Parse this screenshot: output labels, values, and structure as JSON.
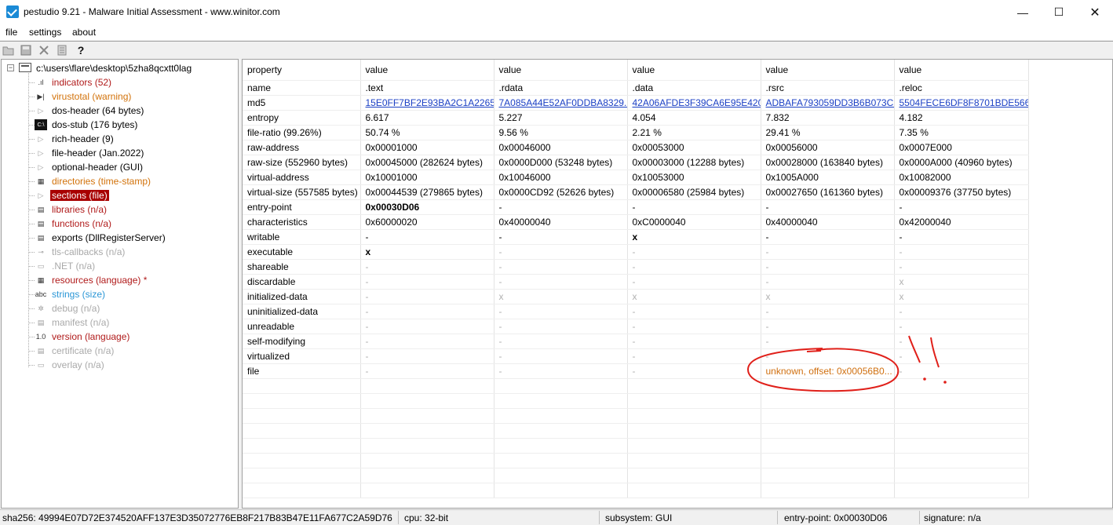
{
  "window": {
    "title": "pestudio 9.21 - Malware Initial Assessment - www.winitor.com",
    "minimize": "—",
    "maximize": "☐",
    "close": "✕"
  },
  "menu": {
    "items": [
      "file",
      "settings",
      "about"
    ]
  },
  "toolbar": {
    "icons": [
      "open-folder-icon",
      "save-icon",
      "close-file-icon",
      "document-icon",
      "help-icon"
    ]
  },
  "tree": {
    "root": "c:\\users\\flare\\desktop\\5zha8qcxtt0lag",
    "items": [
      {
        "label": "indicators (52)",
        "color": "red",
        "icon": "bar-chart-icon"
      },
      {
        "label": "virustotal (warning)",
        "color": "orange",
        "icon": "virustotal-icon"
      },
      {
        "label": "dos-header (64 bytes)",
        "color": "black",
        "icon": "expander-icon"
      },
      {
        "label": "dos-stub (176 bytes)",
        "color": "black",
        "icon": "console-icon"
      },
      {
        "label": "rich-header (9)",
        "color": "black",
        "icon": "expander-icon"
      },
      {
        "label": "file-header (Jan.2022)",
        "color": "black",
        "icon": "expander-icon"
      },
      {
        "label": "optional-header (GUI)",
        "color": "black",
        "icon": "expander-icon"
      },
      {
        "label": "directories (time-stamp)",
        "color": "orange",
        "icon": "directories-icon"
      },
      {
        "label": "sections (file)",
        "color": "selected",
        "icon": "expander-icon"
      },
      {
        "label": "libraries (n/a)",
        "color": "red",
        "icon": "libraries-icon"
      },
      {
        "label": "functions (n/a)",
        "color": "red",
        "icon": "functions-icon"
      },
      {
        "label": "exports (DllRegisterServer)",
        "color": "black",
        "icon": "exports-icon"
      },
      {
        "label": "tls-callbacks (n/a)",
        "color": "gray",
        "icon": "tls-icon"
      },
      {
        "label": ".NET (n/a)",
        "color": "gray",
        "icon": "dotnet-icon"
      },
      {
        "label": "resources (language) *",
        "color": "red",
        "icon": "resources-icon"
      },
      {
        "label": "strings (size)",
        "color": "blue",
        "icon": "strings-icon"
      },
      {
        "label": "debug (n/a)",
        "color": "gray",
        "icon": "debug-icon"
      },
      {
        "label": "manifest (n/a)",
        "color": "gray",
        "icon": "manifest-icon"
      },
      {
        "label": "version (language)",
        "color": "red",
        "icon": "version-icon"
      },
      {
        "label": "certificate (n/a)",
        "color": "gray",
        "icon": "certificate-icon"
      },
      {
        "label": "overlay (n/a)",
        "color": "gray",
        "icon": "overlay-icon"
      }
    ],
    "icon_glyphs": {
      "bar-chart-icon": ".ıl",
      "virustotal-icon": "▶|",
      "console-icon": "C:\\",
      "directories-icon": "▦",
      "libraries-icon": "▤",
      "functions-icon": "▤",
      "exports-icon": "▤",
      "tls-icon": "⊸",
      "dotnet-icon": "▭",
      "resources-icon": "▦",
      "strings-icon": "abc",
      "debug-icon": "✲",
      "manifest-icon": "▤",
      "version-icon": "1.0",
      "certificate-icon": "▤",
      "overlay-icon": "▭"
    }
  },
  "table": {
    "headers": [
      "property",
      "value",
      "value",
      "value",
      "value",
      "value"
    ],
    "rows": [
      {
        "cells": [
          "name",
          ".text",
          ".rdata",
          ".data",
          ".rsrc",
          ".reloc"
        ]
      },
      {
        "cells": [
          "md5",
          "15E0FF7BF2E93BA2C1A2265...",
          "7A085A44E52AF0DDBA8329...",
          "42A06AFDE3F39CA6E95E420...",
          "ADBAFA793059DD3B6B073C...",
          "5504FECE6DF8F8701BDE566..."
        ],
        "style": "link"
      },
      {
        "cells": [
          "entropy",
          "6.617",
          "5.227",
          "4.054",
          "7.832",
          "4.182"
        ]
      },
      {
        "cells": [
          "file-ratio (99.26%)",
          "50.74 %",
          "9.56 %",
          "2.21 %",
          "29.41 %",
          "7.35 %"
        ]
      },
      {
        "cells": [
          "raw-address",
          "0x00001000",
          "0x00046000",
          "0x00053000",
          "0x00056000",
          "0x0007E000"
        ]
      },
      {
        "cells": [
          "raw-size (552960 bytes)",
          "0x00045000 (282624 bytes)",
          "0x0000D000 (53248 bytes)",
          "0x00003000 (12288 bytes)",
          "0x00028000 (163840 bytes)",
          "0x0000A000 (40960 bytes)"
        ]
      },
      {
        "cells": [
          "virtual-address",
          "0x10001000",
          "0x10046000",
          "0x10053000",
          "0x1005A000",
          "0x10082000"
        ]
      },
      {
        "cells": [
          "virtual-size (557585 bytes)",
          "0x00044539 (279865 bytes)",
          "0x0000CD92 (52626 bytes)",
          "0x00006580 (25984 bytes)",
          "0x00027650 (161360 bytes)",
          "0x00009376 (37750 bytes)"
        ]
      },
      {
        "cells": [
          "entry-point",
          "0x00030D06",
          "-",
          "-",
          "-",
          "-"
        ],
        "bold_first_value": true
      },
      {
        "cells": [
          "characteristics",
          "0x60000020",
          "0x40000040",
          "0xC0000040",
          "0x40000040",
          "0x42000040"
        ]
      },
      {
        "cells": [
          "writable",
          "-",
          "-",
          "x",
          "-",
          "-"
        ],
        "bold_x": true
      },
      {
        "cells": [
          "executable",
          "x",
          "-",
          "-",
          "-",
          "-"
        ],
        "bold_x": true,
        "dim_rest": true
      },
      {
        "cells": [
          "shareable",
          "-",
          "-",
          "-",
          "-",
          "-"
        ],
        "dim": true
      },
      {
        "cells": [
          "discardable",
          "-",
          "-",
          "-",
          "-",
          "x"
        ],
        "dim": true
      },
      {
        "cells": [
          "initialized-data",
          "-",
          "x",
          "x",
          "x",
          "x"
        ],
        "dim": true
      },
      {
        "cells": [
          "uninitialized-data",
          "-",
          "-",
          "-",
          "-",
          "-"
        ],
        "dim": true
      },
      {
        "cells": [
          "unreadable",
          "-",
          "-",
          "-",
          "-",
          "-"
        ],
        "dim": true
      },
      {
        "cells": [
          "self-modifying",
          "-",
          "-",
          "-",
          "-",
          "-"
        ],
        "dim": true
      },
      {
        "cells": [
          "virtualized",
          "-",
          "-",
          "-",
          "-",
          "-"
        ],
        "dim": true
      },
      {
        "cells": [
          "file",
          "-",
          "-",
          "-",
          "unknown, offset: 0x00056B0...",
          "-"
        ],
        "dim": true,
        "warn_col": 4
      }
    ]
  },
  "statusbar": {
    "sha256": "sha256: 49994E07D72E374520AFF137E3D35072776EB8F217B83B47E11FA677C2A59D76",
    "cpu": "cpu: 32-bit",
    "subsystem": "subsystem: GUI",
    "entry_point": "entry-point: 0x00030D06",
    "signature": "signature: n/a"
  },
  "colors": {
    "red": "#b01a1a",
    "orange": "#d2720a",
    "blue": "#2a96d6",
    "selected_bg": "#a80000",
    "link": "#1a3fc4",
    "annotation": "#e0201a"
  }
}
